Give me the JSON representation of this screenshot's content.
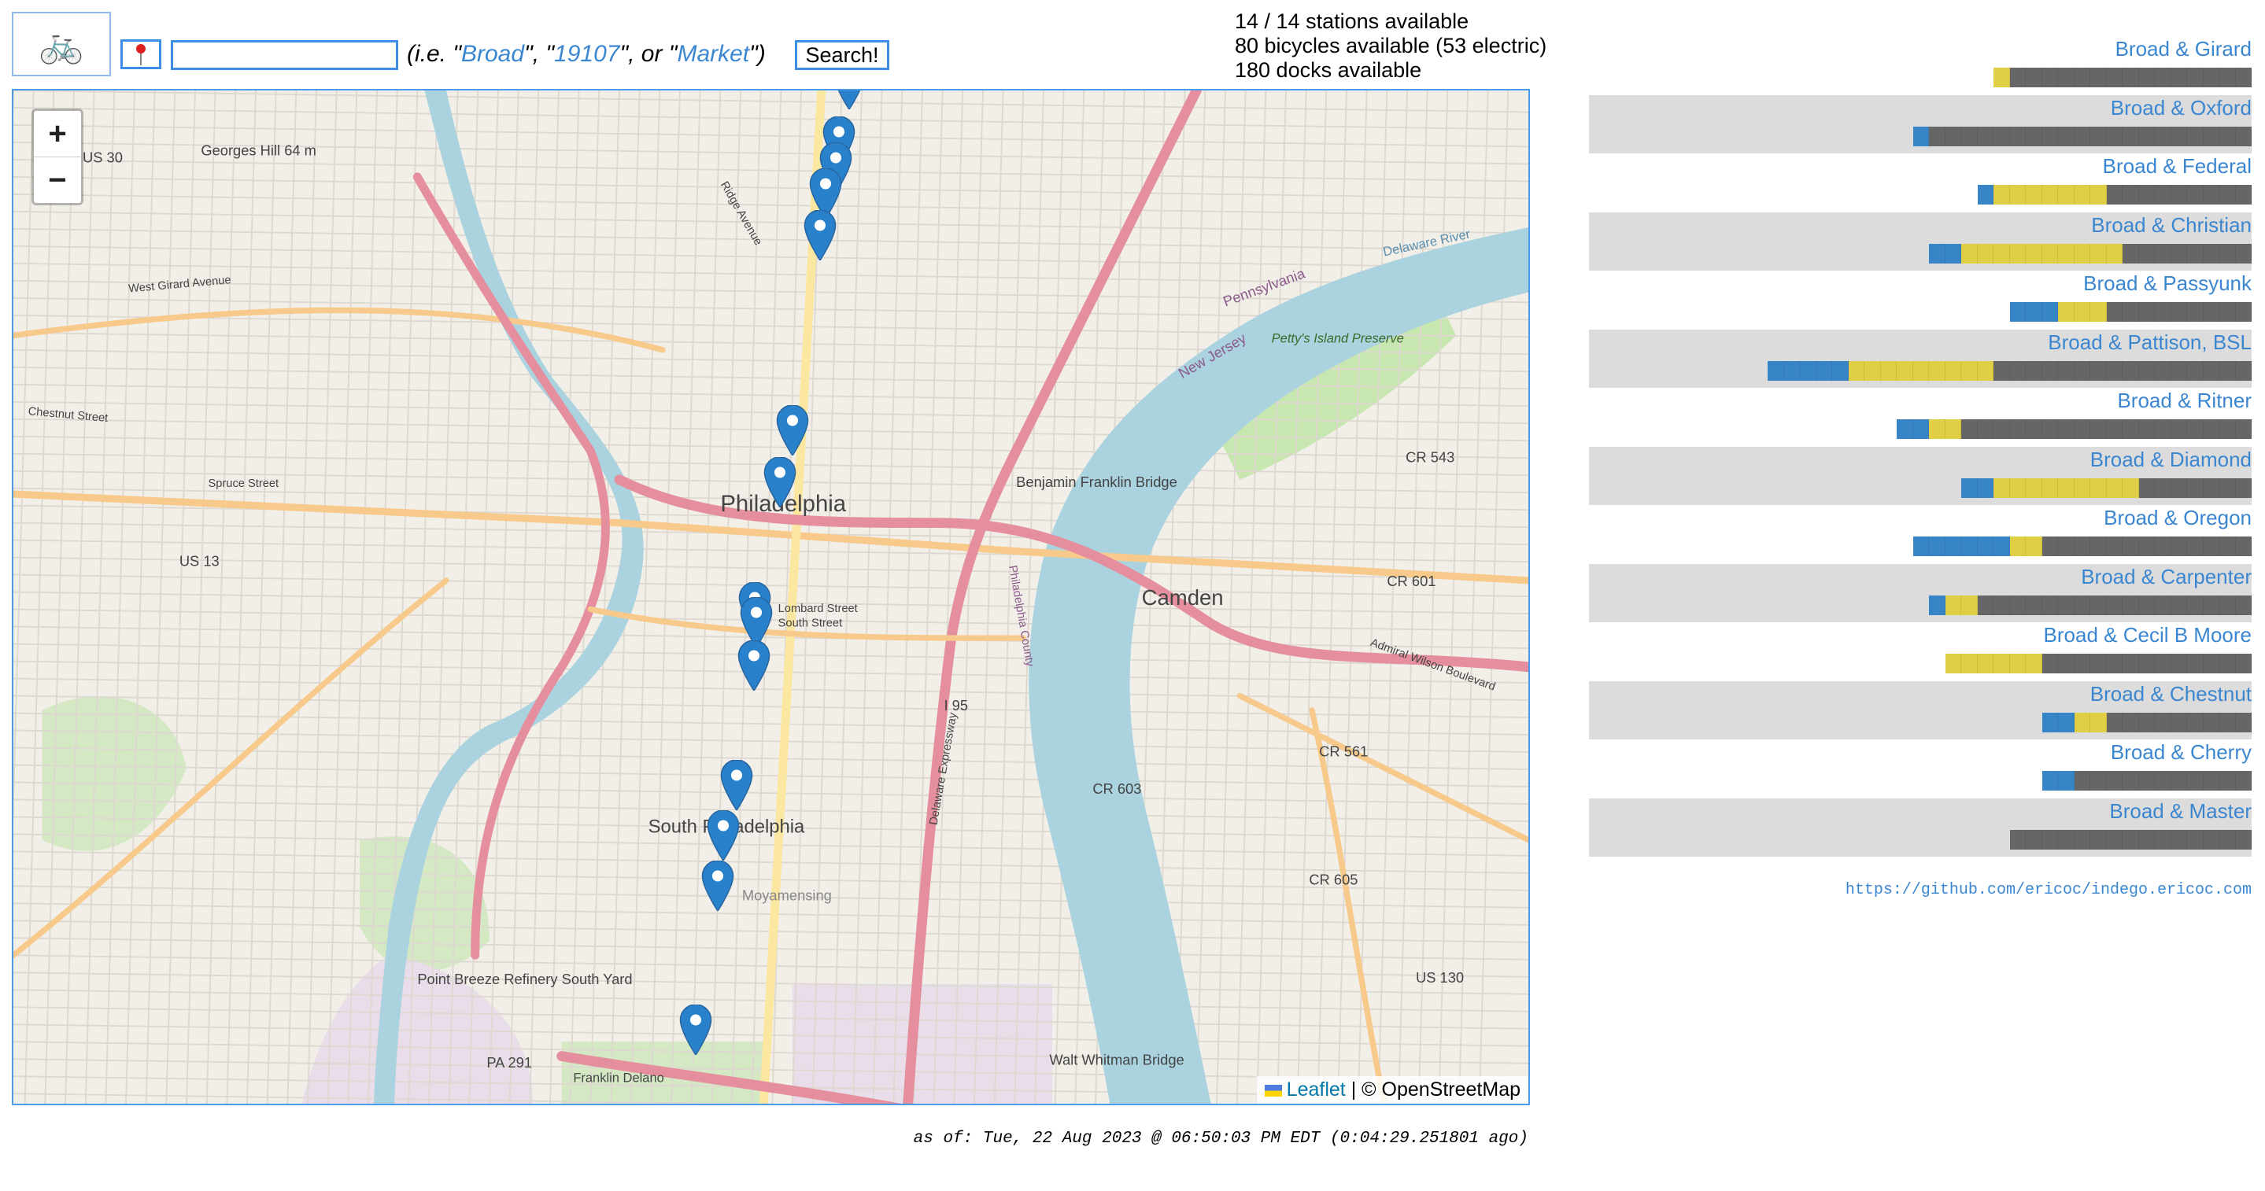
{
  "header": {
    "bike_icon": "bicycle-emoji",
    "pin_icon": "round-pushpin",
    "search_value": "",
    "search_placeholder": "",
    "hint_prefix": "(i.e. \"",
    "hint_ex1": "Broad",
    "hint_mid1": "\", \"",
    "hint_ex2": "19107",
    "hint_mid2": "\", or \"",
    "hint_ex3": "Market",
    "hint_suffix": "\")",
    "search_label": "Search!"
  },
  "stats": {
    "stations": "14 / 14 stations available",
    "bikes": "80 bicycles available (53 electric)",
    "docks": "180 docks available"
  },
  "map": {
    "zoom_in": "+",
    "zoom_out": "−",
    "attribution_leaflet": "Leaflet",
    "attribution_sep": "|",
    "attribution_osm": "© OpenStreetMap",
    "labels": [
      "Philadelphia",
      "Camden",
      "South Philadelphia",
      "Benjamin Franklin Bridge",
      "Walt Whitman Bridge",
      "Petty's Island Preserve",
      "Delaware River",
      "Pennsylvania",
      "New Jersey",
      "Moyamensing",
      "Point Breeze Refinery South Yard",
      "Georges Hill 64 m",
      "I 95",
      "US 30",
      "US 13",
      "CR 543",
      "CR 601",
      "CR 561",
      "CR 603",
      "CR 605",
      "US 130",
      "PA 291",
      "Chestnut Street",
      "Spruce Street",
      "West Girard Avenue",
      "Lombard Street",
      "South Street",
      "Ridge Avenue",
      "Philadelphia County",
      "Delaware Expressway",
      "Admiral Wilson Boulevard",
      "Franklin Delano"
    ]
  },
  "colors": {
    "classic": "#3784c6",
    "electric": "#e0ce44",
    "dock": "#666666",
    "link": "#3a86d0",
    "border": "#4a9bea"
  },
  "stations": [
    {
      "name": "Broad & Girard",
      "classic": 0,
      "electric": 1,
      "docks": 15
    },
    {
      "name": "Broad & Oxford",
      "classic": 1,
      "electric": 0,
      "docks": 20
    },
    {
      "name": "Broad & Federal",
      "classic": 1,
      "electric": 7,
      "docks": 9
    },
    {
      "name": "Broad & Christian",
      "classic": 2,
      "electric": 10,
      "docks": 8
    },
    {
      "name": "Broad & Passyunk",
      "classic": 3,
      "electric": 3,
      "docks": 9
    },
    {
      "name": "Broad & Pattison, BSL",
      "classic": 5,
      "electric": 9,
      "docks": 16
    },
    {
      "name": "Broad & Ritner",
      "classic": 2,
      "electric": 2,
      "docks": 18
    },
    {
      "name": "Broad & Diamond",
      "classic": 2,
      "electric": 9,
      "docks": 7
    },
    {
      "name": "Broad & Oregon",
      "classic": 6,
      "electric": 2,
      "docks": 13
    },
    {
      "name": "Broad & Carpenter",
      "classic": 1,
      "electric": 2,
      "docks": 17
    },
    {
      "name": "Broad & Cecil B Moore",
      "classic": 0,
      "electric": 6,
      "docks": 13
    },
    {
      "name": "Broad & Chestnut",
      "classic": 2,
      "electric": 2,
      "docks": 9
    },
    {
      "name": "Broad & Cherry",
      "classic": 2,
      "electric": 0,
      "docks": 11
    },
    {
      "name": "Broad & Master",
      "classic": 0,
      "electric": 0,
      "docks": 15
    }
  ],
  "footer": {
    "as_of": "as of: Tue, 22 Aug 2023 @ 06:50:03 PM EDT (0:04:29.251801 ago)",
    "github": "https://github.com/ericoc/indego.ericoc.com"
  }
}
